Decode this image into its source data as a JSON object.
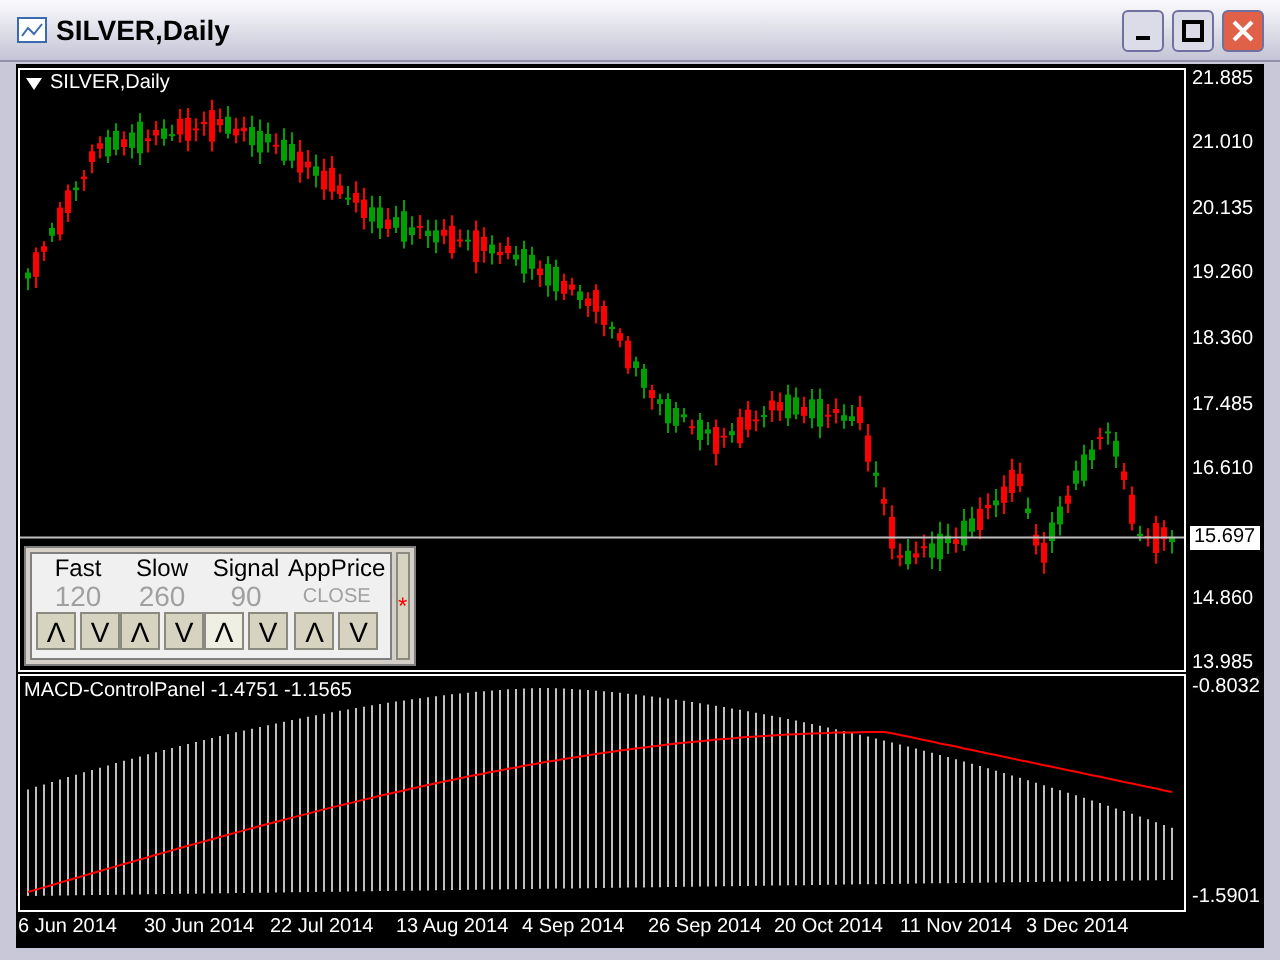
{
  "window": {
    "title": "SILVER,Daily"
  },
  "chart": {
    "label": "SILVER,Daily",
    "price_ticks": [
      "21.885",
      "21.010",
      "20.135",
      "19.260",
      "18.360",
      "17.485",
      "16.610",
      "14.860",
      "13.985"
    ],
    "current_price": "15.697"
  },
  "control_panel": {
    "columns": [
      {
        "label": "Fast",
        "value": "120",
        "up": {
          "symbol": "Λ",
          "highlighted": false
        },
        "down": {
          "symbol": "V",
          "highlighted": false
        }
      },
      {
        "label": "Slow",
        "value": "260",
        "up": {
          "symbol": "Λ",
          "highlighted": false
        },
        "down": {
          "symbol": "V",
          "highlighted": false
        }
      },
      {
        "label": "Signal",
        "value": "90",
        "up": {
          "symbol": "Λ",
          "highlighted": true
        },
        "down": {
          "symbol": "V",
          "highlighted": false
        }
      },
      {
        "label": "AppPrice",
        "value": "CLOSE",
        "up": {
          "symbol": "Λ",
          "highlighted": false
        },
        "down": {
          "symbol": "V",
          "highlighted": false
        }
      }
    ],
    "side_button": "*"
  },
  "indicator": {
    "label": "MACD-ControlPanel -1.4751 -1.1565",
    "ticks": [
      "-0.8032",
      "-1.5901"
    ]
  },
  "date_axis": [
    "6 Jun 2014",
    "30 Jun 2014",
    "22 Jul 2014",
    "13 Aug 2014",
    "4 Sep 2014",
    "26 Sep 2014",
    "20 Oct 2014",
    "11 Nov 2014",
    "3 Dec 2014"
  ]
}
